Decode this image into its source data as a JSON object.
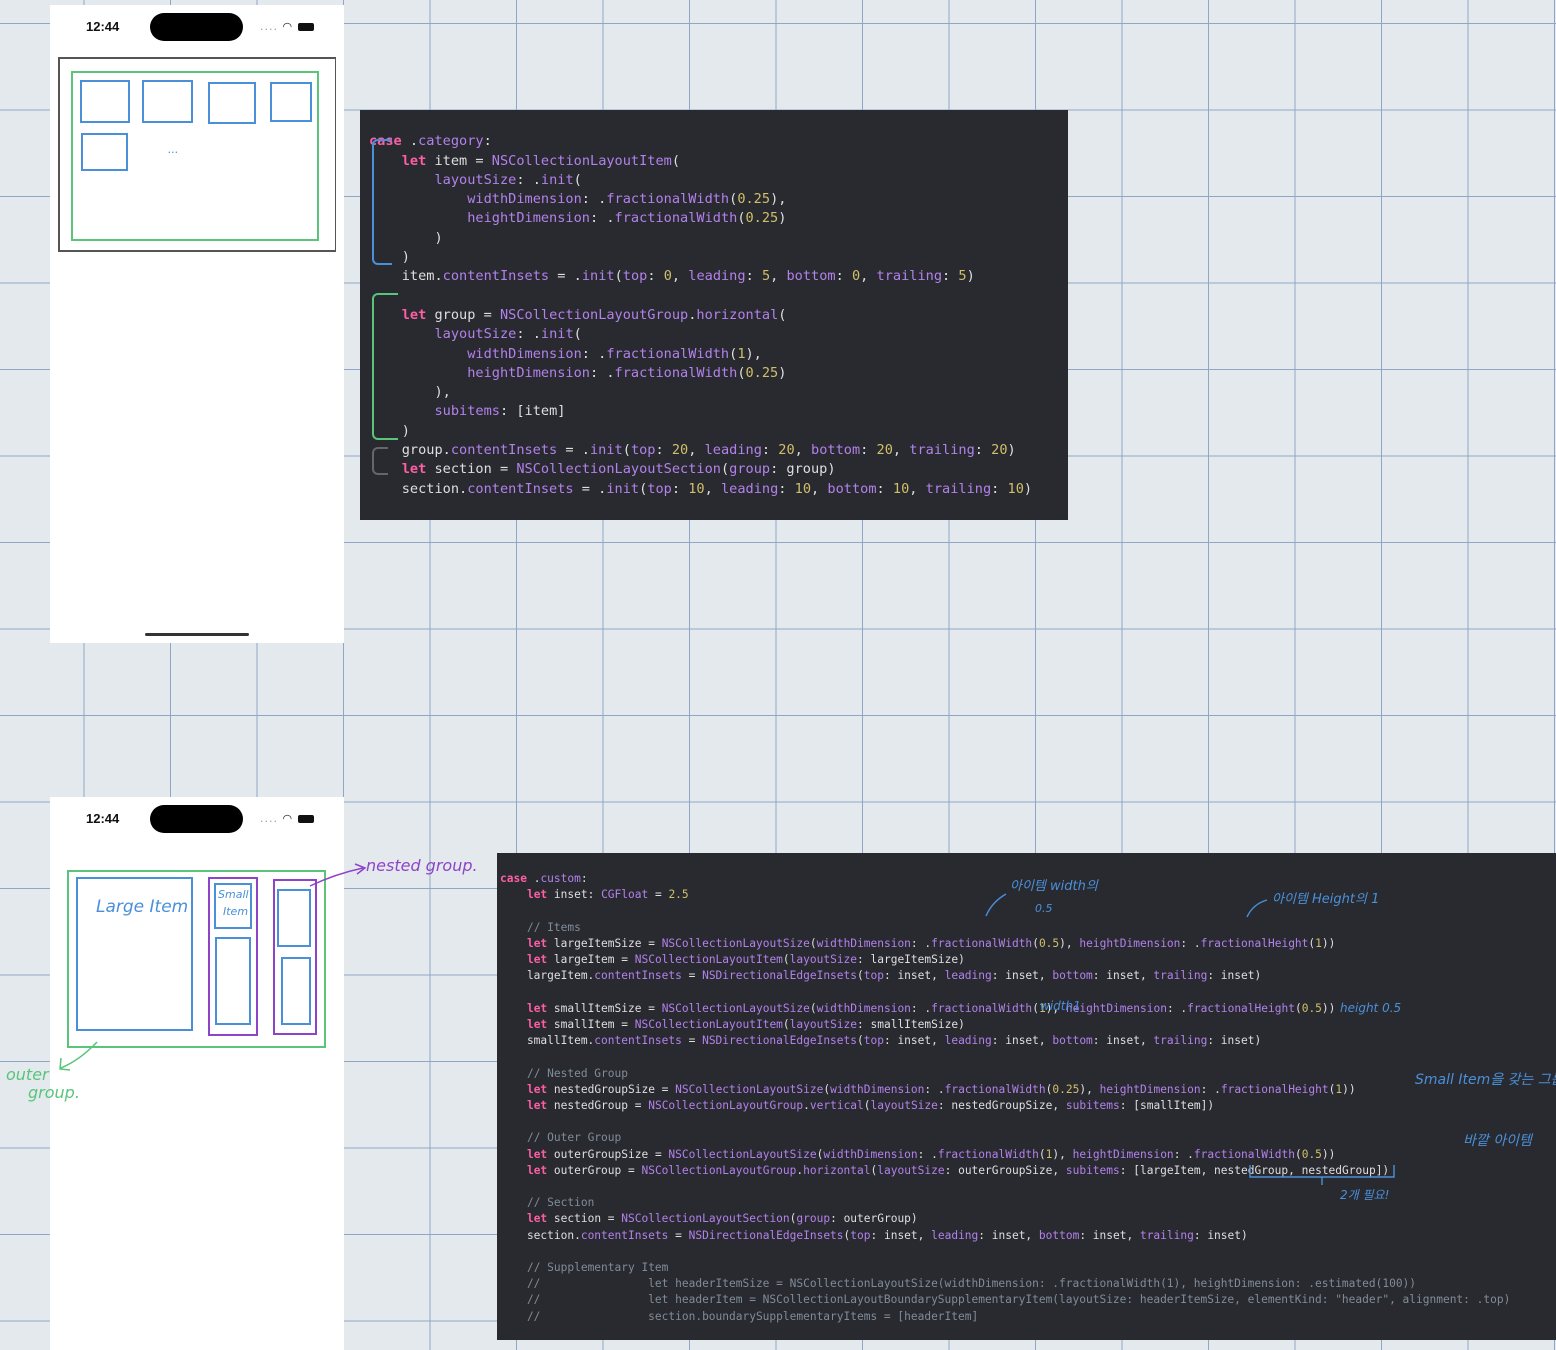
{
  "phone_top": {
    "time": "12:44",
    "status_icons": ".... ◠ ▬",
    "ellipsis": "..."
  },
  "phone_bottom": {
    "time": "12:44",
    "status_icons": ".... ◠ ▬",
    "large_item_label": "Large Item",
    "small_item_label_1": "Small",
    "small_item_label_2": "Item"
  },
  "handwritten": {
    "nested_group": "nested group.",
    "outer_group_1": "outer",
    "outer_group_2": "group.",
    "item_width": "아이템 width의",
    "item_width_value": "0.5",
    "item_height": "아이템 Height의 1",
    "width_one": "width1",
    "height_half": "height 0.5",
    "small_item_group": "Small Item을 갖는 그룹",
    "outer_item": "바깥 아이템",
    "two_needed": "2개 필요!"
  },
  "colors": {
    "item_blue": "#4a90d9",
    "group_green": "#59c47a",
    "nested_purple": "#8e44c9",
    "code_bg": "#292a30",
    "keyword": "#fc5fa3",
    "property": "#b281eb",
    "number": "#d0bf69",
    "comment": "#7f8c98"
  }
}
